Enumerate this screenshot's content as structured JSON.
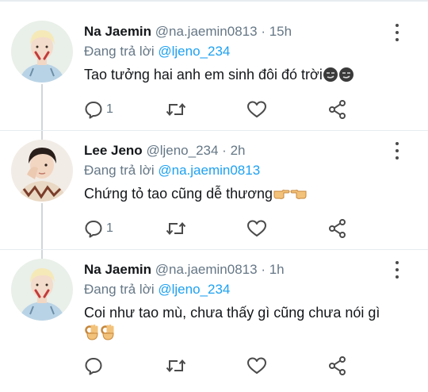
{
  "tweets": [
    {
      "name": "Na Jaemin",
      "handle": "@na.jaemin0813",
      "separator": "·",
      "time": "15h",
      "reply_prefix": "Đang trả lời",
      "reply_to": "@ljeno_234",
      "text": "Tao tưởng hai anh em sinh đôi đó trời",
      "emoji": [
        "smirk-face",
        "smirk-face"
      ],
      "reply_count": "1"
    },
    {
      "name": "Lee Jeno",
      "handle": "@ljeno_234",
      "separator": "·",
      "time": "2h",
      "reply_prefix": "Đang trả lời",
      "reply_to": "@na.jaemin0813",
      "text": "Chứng tỏ tao cũng dễ thương",
      "emoji": [
        "pointing-right-hand",
        "pointing-left-hand"
      ],
      "reply_count": "1"
    },
    {
      "name": "Na Jaemin",
      "handle": "@na.jaemin0813",
      "separator": "·",
      "time": "1h",
      "reply_prefix": "Đang trả lời",
      "reply_to": "@ljeno_234",
      "text": "Coi như tao mù, chưa thấy gì cũng chưa nói gì",
      "emoji": [
        "ok-hand",
        "ok-hand"
      ],
      "reply_count": ""
    }
  ],
  "icons": {
    "reply": "reply-icon",
    "retweet": "retweet-icon",
    "like": "like-icon",
    "share": "share-icon",
    "more": "more-options-icon"
  },
  "colors": {
    "link": "#1da1f2",
    "muted": "#657786",
    "text": "#14171a",
    "thread_line": "#d0d6da"
  }
}
